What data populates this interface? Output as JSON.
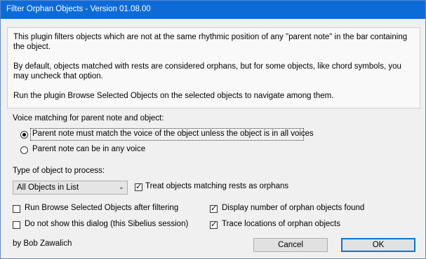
{
  "window": {
    "title": "Filter Orphan Objects - Version 01.08.00"
  },
  "description": {
    "para1": "This plugin filters objects which are not at the same rhythmic position of any \"parent note\" in the bar containing the object.",
    "para2": "By default, objects matched with rests are considered orphans, but for some objects, like chord symbols, you may uncheck that option.",
    "para3": "Run the plugin Browse Selected Objects on the selected objects to navigate among them."
  },
  "voice_matching": {
    "heading": "Voice matching for parent note and object:",
    "options": [
      {
        "label": "Parent note must match the voice of the object unless the object is in all voices",
        "selected": true
      },
      {
        "label": "Parent note can be in any voice",
        "selected": false
      }
    ]
  },
  "object_type": {
    "heading": "Type of object to process:",
    "selected": "All Objects in List",
    "arrow_icon": "chevron-down-icon"
  },
  "checkboxes": {
    "treat_rests": {
      "label": "Treat objects matching rests as orphans",
      "checked": true
    },
    "run_browse": {
      "label": "Run Browse Selected Objects after filtering",
      "checked": false
    },
    "display_count": {
      "label": "Display number of orphan objects found",
      "checked": true
    },
    "no_show": {
      "label": "Do not show this dialog (this Sibelius session)",
      "checked": false
    },
    "trace": {
      "label": "Trace locations of orphan objects",
      "checked": true
    }
  },
  "footer": {
    "credit": "by Bob Zawalich"
  },
  "buttons": {
    "cancel": "Cancel",
    "ok": "OK"
  },
  "colors": {
    "titlebar": "#0d6bd8",
    "ok_border": "#0078d7"
  }
}
